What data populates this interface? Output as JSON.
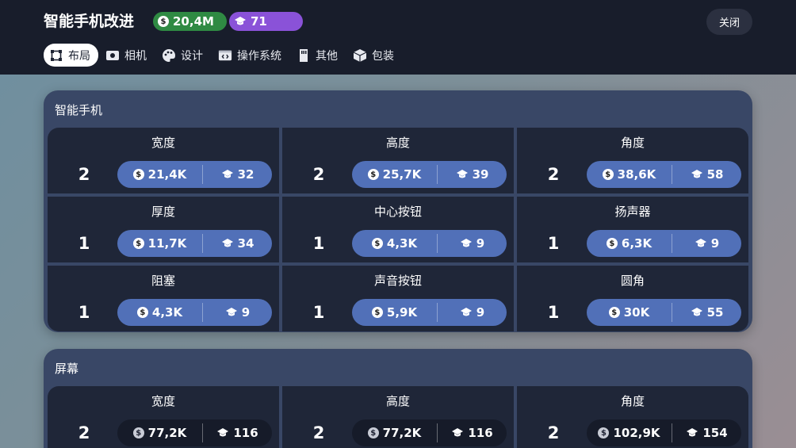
{
  "header": {
    "title": "智能手机改进",
    "money": "20,4M",
    "points": "71",
    "close_label": "关闭"
  },
  "tabs": [
    {
      "label": "布局",
      "icon": "layout-icon",
      "active": true
    },
    {
      "label": "相机",
      "icon": "camera-icon",
      "active": false
    },
    {
      "label": "设计",
      "icon": "palette-icon",
      "active": false
    },
    {
      "label": "操作系统",
      "icon": "code-icon",
      "active": false
    },
    {
      "label": "其他",
      "icon": "sd-card-icon",
      "active": false
    },
    {
      "label": "包装",
      "icon": "box-icon",
      "active": false
    }
  ],
  "sections": [
    {
      "title": "智能手机",
      "items": [
        {
          "name": "宽度",
          "level": "2",
          "cost": "21,4K",
          "points": "32",
          "affordable": true
        },
        {
          "name": "高度",
          "level": "2",
          "cost": "25,7K",
          "points": "39",
          "affordable": true
        },
        {
          "name": "角度",
          "level": "2",
          "cost": "38,6K",
          "points": "58",
          "affordable": true
        },
        {
          "name": "厚度",
          "level": "1",
          "cost": "11,7K",
          "points": "34",
          "affordable": true
        },
        {
          "name": "中心按钮",
          "level": "1",
          "cost": "4,3K",
          "points": "9",
          "affordable": true
        },
        {
          "name": "扬声器",
          "level": "1",
          "cost": "6,3K",
          "points": "9",
          "affordable": true
        },
        {
          "name": "阻塞",
          "level": "1",
          "cost": "4,3K",
          "points": "9",
          "affordable": true
        },
        {
          "name": "声音按钮",
          "level": "1",
          "cost": "5,9K",
          "points": "9",
          "affordable": true
        },
        {
          "name": "圆角",
          "level": "1",
          "cost": "30K",
          "points": "55",
          "affordable": true
        }
      ]
    },
    {
      "title": "屏幕",
      "items": [
        {
          "name": "宽度",
          "level": "2",
          "cost": "77,2K",
          "points": "116",
          "affordable": false
        },
        {
          "name": "高度",
          "level": "2",
          "cost": "77,2K",
          "points": "116",
          "affordable": false
        },
        {
          "name": "角度",
          "level": "2",
          "cost": "102,9K",
          "points": "154",
          "affordable": false
        }
      ]
    }
  ],
  "colors": {
    "money_pill": "#2f8a43",
    "points_pill": "#8a52d8",
    "upgrade_affordable": "#5170b8",
    "upgrade_unaffordable": "#161b29"
  }
}
